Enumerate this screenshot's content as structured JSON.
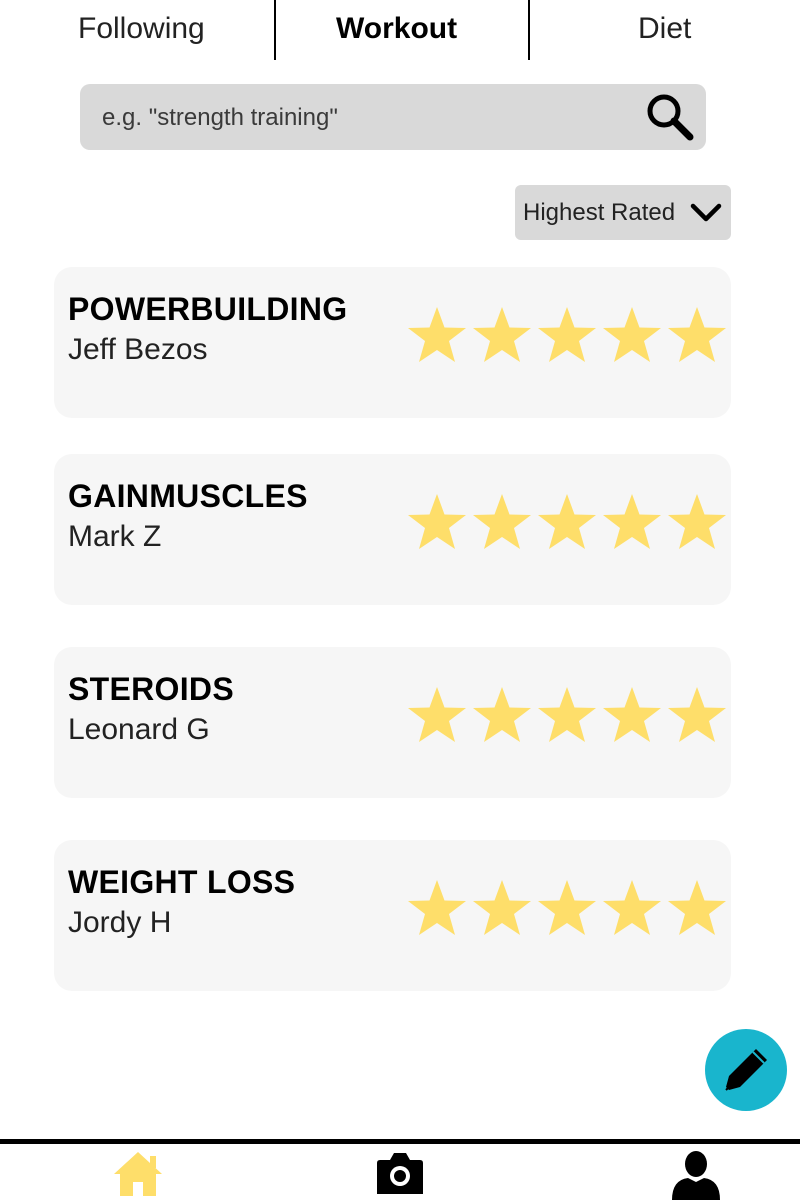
{
  "tabs": [
    {
      "label": "Following",
      "active": false
    },
    {
      "label": "Workout",
      "active": true
    },
    {
      "label": "Diet",
      "active": false
    }
  ],
  "search": {
    "placeholder": "e.g. \"strength training\"",
    "value": "",
    "icon": "search-icon"
  },
  "sort": {
    "selected": "Highest Rated",
    "icon": "chevron-down-icon"
  },
  "workouts": [
    {
      "title": "POWERBUILDING",
      "author": "Jeff Bezos",
      "rating": 5,
      "max_rating": 5
    },
    {
      "title": "GAINMUSCLES",
      "author": "Mark Z",
      "rating": 5,
      "max_rating": 5
    },
    {
      "title": "STEROIDS",
      "author": "Leonard G",
      "rating": 5,
      "max_rating": 5
    },
    {
      "title": "WEIGHT LOSS",
      "author": "Jordy H",
      "rating": 5,
      "max_rating": 5
    }
  ],
  "fab": {
    "icon": "pen-icon",
    "color": "#19b5cd"
  },
  "bottom_nav": [
    {
      "icon": "home-icon",
      "active": true
    },
    {
      "icon": "camera-icon",
      "active": false
    },
    {
      "icon": "profile-icon",
      "active": false
    }
  ],
  "colors": {
    "star": "#fede6a",
    "accent": "#19b5cd",
    "home_active": "#fede6a",
    "card_bg": "#f6f6f6",
    "search_bg": "#d9d9d9"
  }
}
